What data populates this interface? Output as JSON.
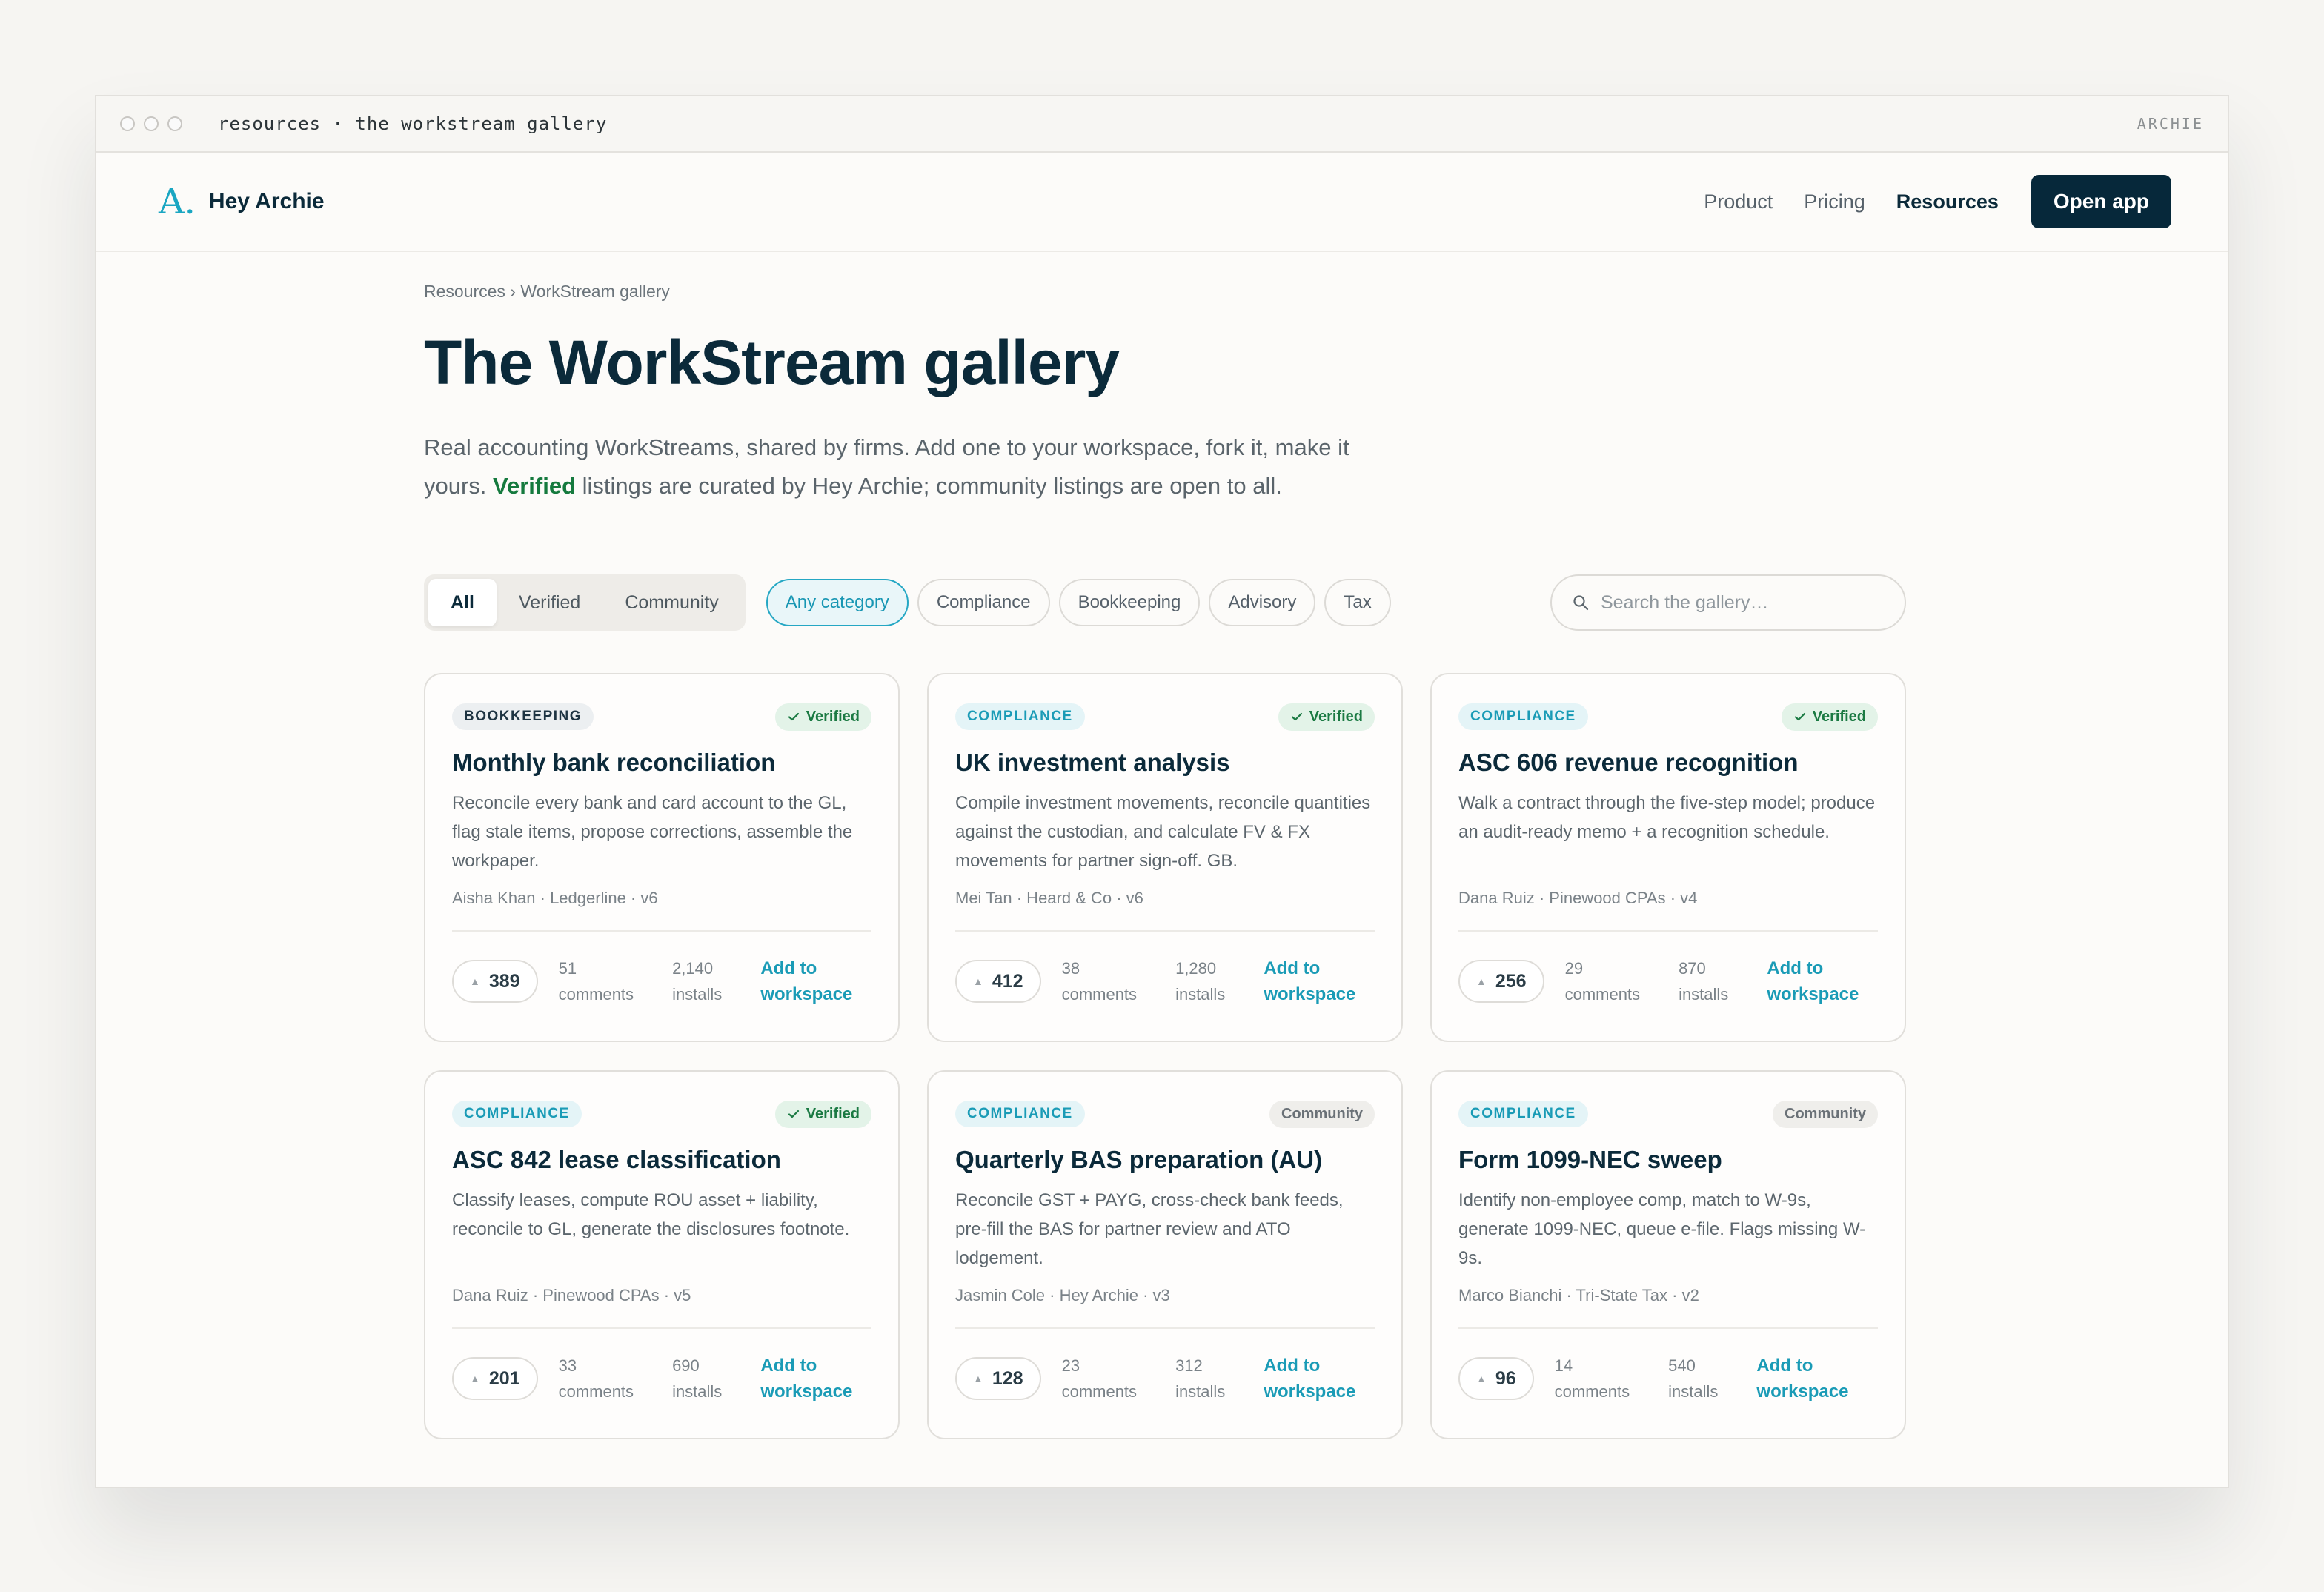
{
  "window": {
    "title": "resources · the workstream gallery",
    "brand": "ARCHIE"
  },
  "nav": {
    "logo_mark": "A.",
    "logo_text": "Hey Archie",
    "links": [
      "Product",
      "Pricing",
      "Resources"
    ],
    "cta": "Open app"
  },
  "page": {
    "breadcrumb": "Resources › WorkStream gallery",
    "title": "The WorkStream gallery",
    "intro_a": "Real accounting WorkStreams, shared by firms. Add one to your workspace, fork it, make it yours. ",
    "intro_verified": "Verified",
    "intro_b": " listings are curated by Hey Archie; community listings are open to all."
  },
  "filters": {
    "segments": [
      "All",
      "Verified",
      "Community"
    ],
    "chips": [
      "Any category",
      "Compliance",
      "Bookkeeping",
      "Advisory",
      "Tax"
    ],
    "search_placeholder": "Search the gallery…"
  },
  "colors": {
    "accent": "#1a9bb6",
    "brand_dark": "#06283a",
    "verified": "#1b7a43"
  },
  "cards": [
    {
      "category": "BOOKKEEPING",
      "badge": "Verified",
      "title": "Monthly bank reconciliation",
      "desc": "Reconcile every bank and card account to the GL, flag stale items, propose corrections, assemble the workpaper.",
      "meta": "Aisha Khan · Ledgerline · v6",
      "votes": "389",
      "comments_n": "51",
      "comments_l": "comments",
      "installs_n": "2,140",
      "installs_l": "installs",
      "add_a": "Add to",
      "add_b": "workspace"
    },
    {
      "category": "COMPLIANCE",
      "badge": "Verified",
      "title": "UK investment analysis",
      "desc": "Compile investment movements, reconcile quantities against the custodian, and calculate FV & FX movements for partner sign-off. GB.",
      "meta": "Mei Tan · Heard & Co · v6",
      "votes": "412",
      "comments_n": "38",
      "comments_l": "comments",
      "installs_n": "1,280",
      "installs_l": "installs",
      "add_a": "Add to",
      "add_b": "workspace"
    },
    {
      "category": "COMPLIANCE",
      "badge": "Verified",
      "title": "ASC 606 revenue recognition",
      "desc": "Walk a contract through the five-step model; produce an audit-ready memo + a recognition schedule.",
      "meta": "Dana Ruiz · Pinewood CPAs · v4",
      "votes": "256",
      "comments_n": "29",
      "comments_l": "comments",
      "installs_n": "870",
      "installs_l": "installs",
      "add_a": "Add to",
      "add_b": "workspace"
    },
    {
      "category": "COMPLIANCE",
      "badge": "Verified",
      "title": "ASC 842 lease classification",
      "desc": "Classify leases, compute ROU asset + liability, reconcile to GL, generate the disclosures footnote.",
      "meta": "Dana Ruiz · Pinewood CPAs · v5",
      "votes": "201",
      "comments_n": "33",
      "comments_l": "comments",
      "installs_n": "690",
      "installs_l": "installs",
      "add_a": "Add to",
      "add_b": "workspace"
    },
    {
      "category": "COMPLIANCE",
      "badge": "Community",
      "title": "Quarterly BAS preparation (AU)",
      "desc": "Reconcile GST + PAYG, cross-check bank feeds, pre-fill the BAS for partner review and ATO lodgement.",
      "meta": "Jasmin Cole · Hey Archie · v3",
      "votes": "128",
      "comments_n": "23",
      "comments_l": "comments",
      "installs_n": "312",
      "installs_l": "installs",
      "add_a": "Add to",
      "add_b": "workspace"
    },
    {
      "category": "COMPLIANCE",
      "badge": "Community",
      "title": "Form 1099-NEC sweep",
      "desc": "Identify non-employee comp, match to W-9s, generate 1099-NEC, queue e-file. Flags missing W-9s.",
      "meta": "Marco Bianchi · Tri-State Tax · v2",
      "votes": "96",
      "comments_n": "14",
      "comments_l": "comments",
      "installs_n": "540",
      "installs_l": "installs",
      "add_a": "Add to",
      "add_b": "workspace"
    }
  ]
}
